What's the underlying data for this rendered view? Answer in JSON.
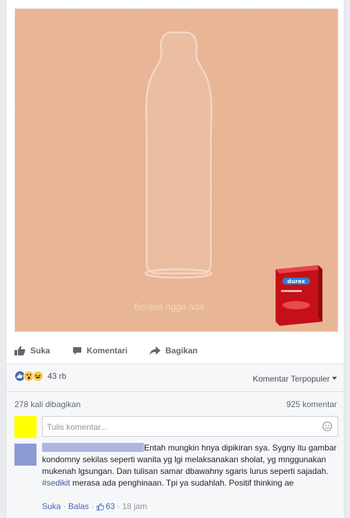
{
  "post": {
    "ad_caption": "Berasa ngga ada",
    "brand": "durex"
  },
  "actions": {
    "like": "Suka",
    "comment": "Komentari",
    "share": "Bagikan"
  },
  "reactions": {
    "count": "43 rb",
    "types": [
      "like-icon",
      "wow-icon",
      "haha-icon"
    ]
  },
  "sort_label": "Komentar Terpopuler",
  "stats": {
    "shares": "278 kali dibagikan",
    "comments": "925 komentar"
  },
  "composer": {
    "placeholder": "Tulis komentar..."
  },
  "comment": {
    "text_before_tag": "Entah mungkin hnya dipikiran sya. Sygny itu gambar kondomny sekilas seperti wanita yg lgi melaksanakan sholat, yg mnggunakan mukenah lgsungan. Dan tulisan samar dbawahny sgaris lurus seperti sajadah. ",
    "hashtag": "#sedikit",
    "text_after_tag": " merasa ada penghinaan. Tpi ya sudahlah. Positif thinking ae",
    "like_label": "Suka",
    "reply_label": "Balas",
    "like_count": "63",
    "time": "18 jam"
  },
  "colors": {
    "skin": "#e9b697",
    "brand_blue": "#4267b2",
    "durex_red": "#d4161f"
  }
}
